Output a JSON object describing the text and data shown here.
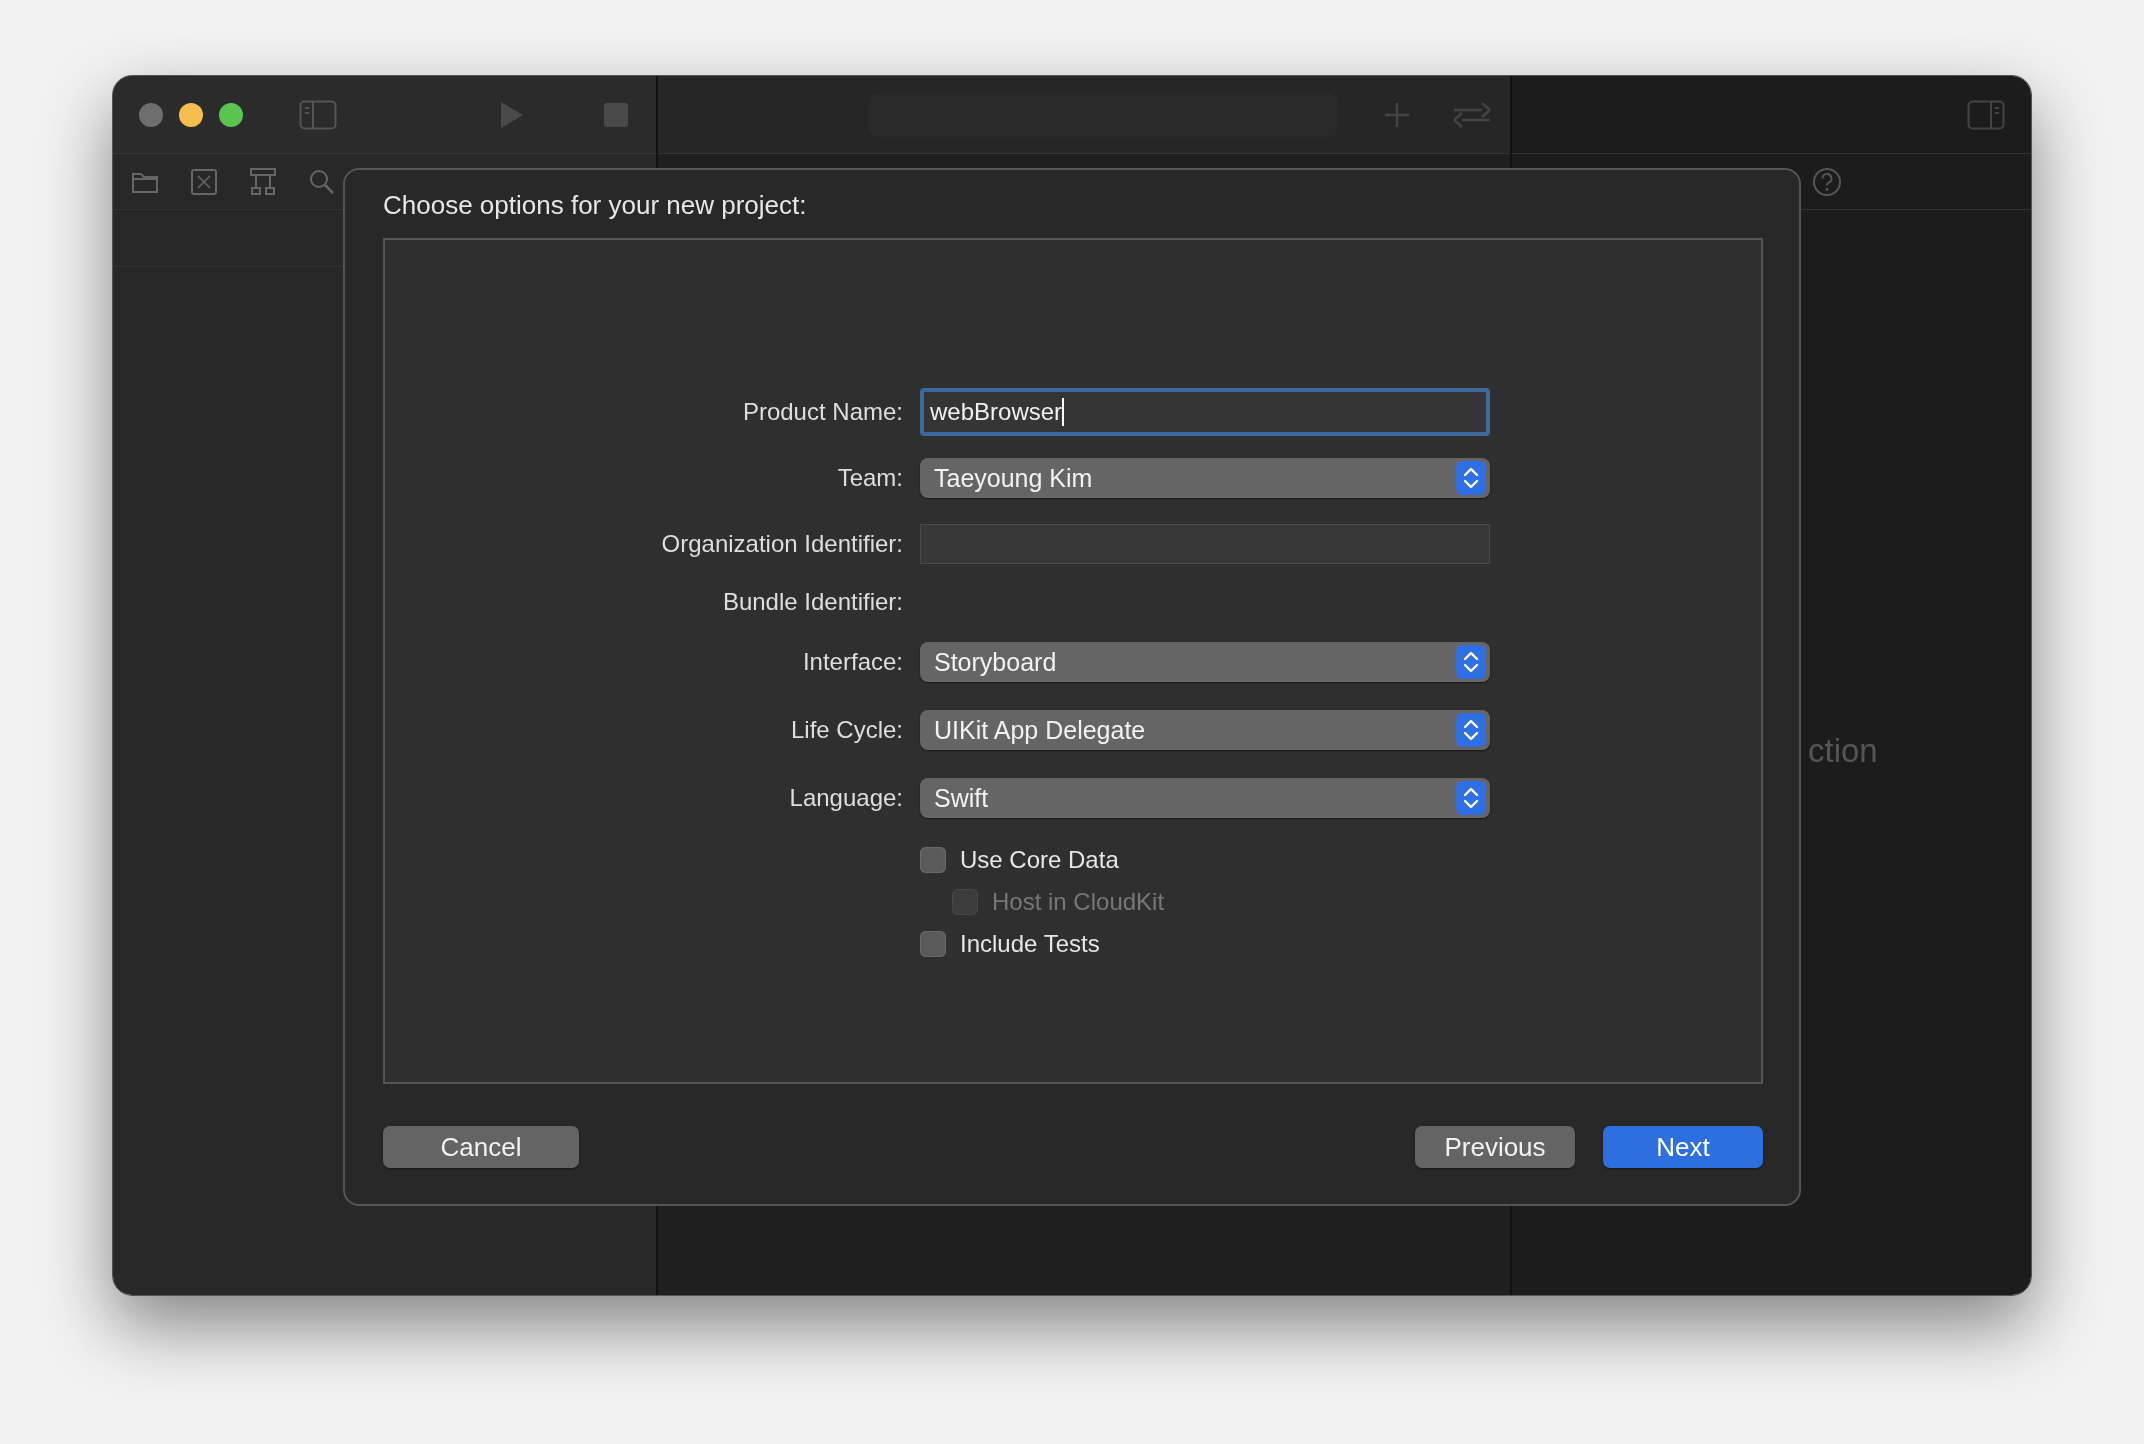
{
  "background_text": "ction",
  "dialog": {
    "title": "Choose options for your new project:",
    "fields": [
      {
        "label": "Product Name:",
        "kind": "text",
        "value": "webBrowser",
        "focused": true
      },
      {
        "label": "Team:",
        "kind": "popup",
        "value": "Taeyoung Kim"
      },
      {
        "label": "Organization Identifier:",
        "kind": "text",
        "focused": false
      },
      {
        "label": "Bundle Identifier:",
        "kind": "static"
      },
      {
        "label": "Interface:",
        "kind": "popup",
        "value": "Storyboard"
      },
      {
        "label": "Life Cycle:",
        "kind": "popup",
        "value": "UIKit App Delegate"
      },
      {
        "label": "Language:",
        "kind": "popup",
        "value": "Swift"
      }
    ],
    "checkboxes": [
      {
        "label": "Use Core Data",
        "checked": false,
        "disabled": false,
        "children": [
          {
            "label": "Host in CloudKit",
            "checked": false,
            "disabled": true
          }
        ]
      },
      {
        "label": "Include Tests",
        "checked": false,
        "disabled": false
      }
    ],
    "buttons_left": [
      {
        "label": "Cancel",
        "primary": false
      }
    ],
    "buttons_right": [
      {
        "label": "Previous",
        "primary": false
      },
      {
        "label": "Next",
        "primary": true
      }
    ]
  }
}
